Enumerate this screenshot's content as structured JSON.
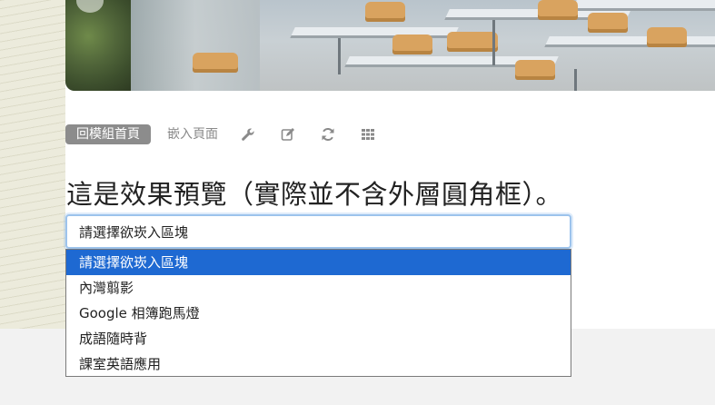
{
  "toolbar": {
    "home_label": "回模組首頁",
    "embed_label": "嵌入頁面",
    "icons": [
      "wrench-icon",
      "edit-icon",
      "refresh-icon",
      "grid-icon"
    ]
  },
  "preview": {
    "title": "這是效果預覽（實際並不含外層圓角框）。"
  },
  "select": {
    "current_value": "請選擇欲崁入區塊",
    "options": [
      "請選擇欲崁入區塊",
      "內灣翦影",
      "Google 相簿跑馬燈",
      "成語隨時背",
      "課室英語應用"
    ],
    "selected_index": 0
  },
  "colors": {
    "badge_bg": "#8c8c8c",
    "selected_option_bg": "#1e69d2",
    "focus_border": "#9cc3ec"
  }
}
